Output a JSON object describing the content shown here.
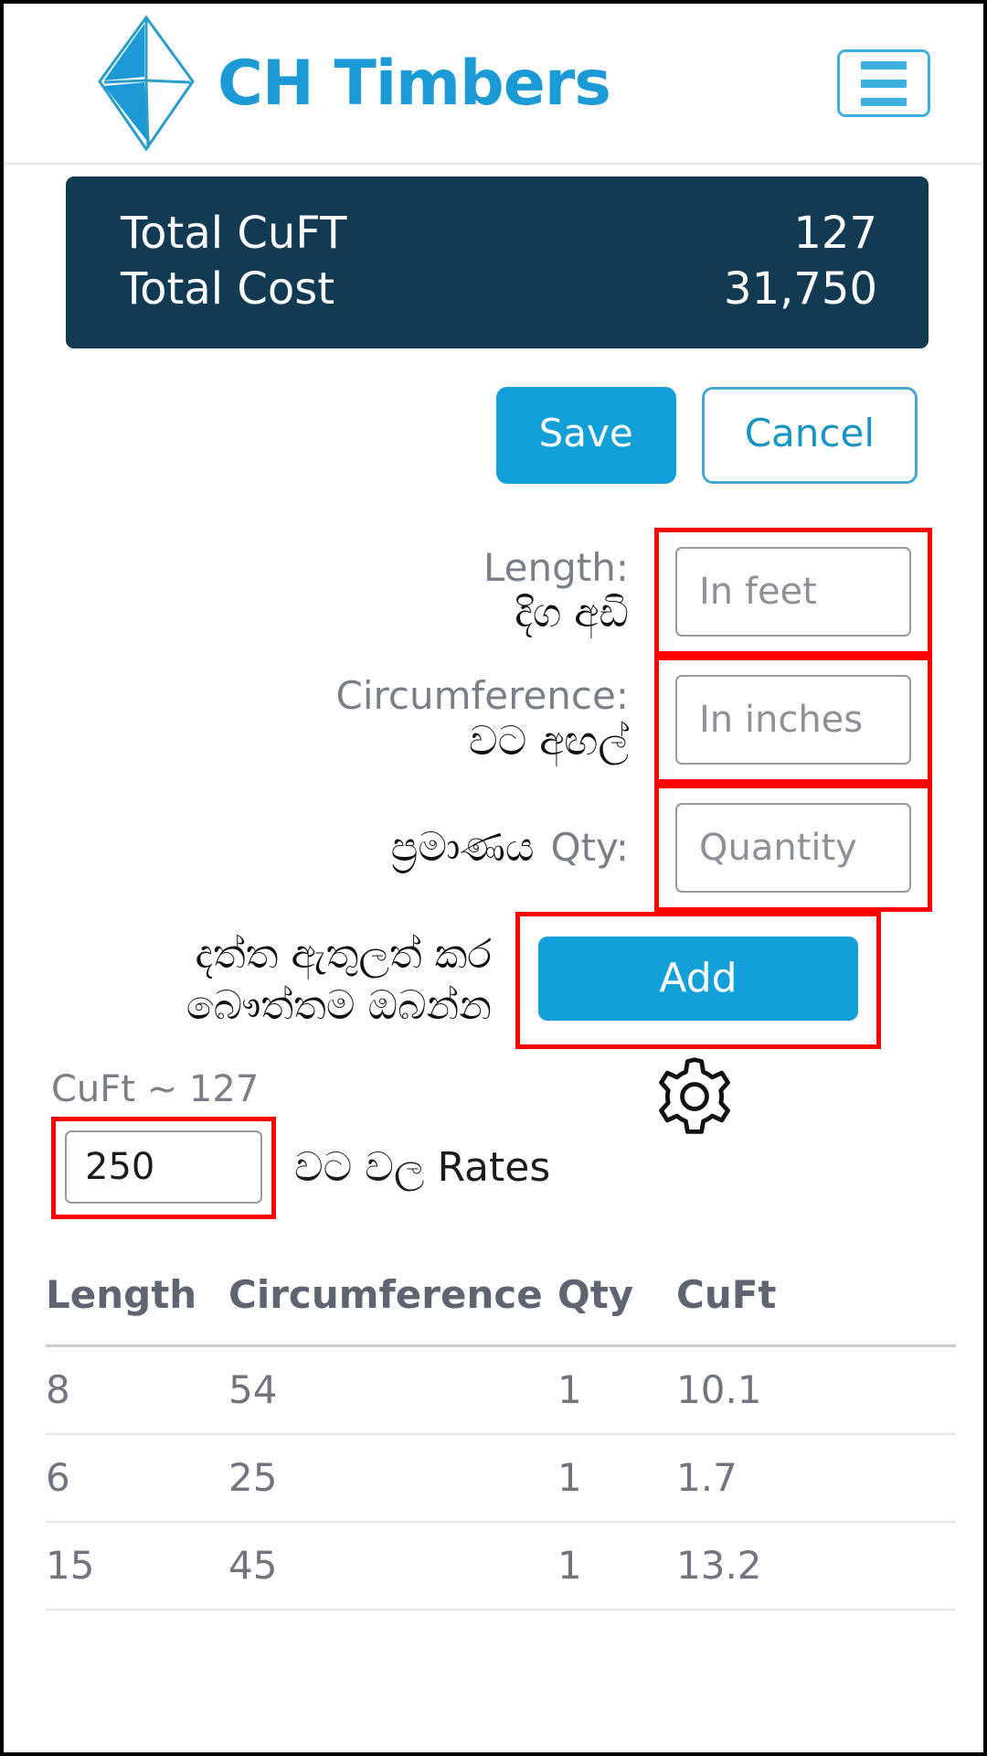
{
  "header": {
    "brand_name": "CH Timbers",
    "logo_icon": "octahedron-diamond-icon",
    "menu_icon": "hamburger-menu-icon"
  },
  "summary": {
    "rows": [
      {
        "label": "Total CuFT",
        "value": "127"
      },
      {
        "label": "Total Cost",
        "value": "31,750"
      }
    ]
  },
  "actions": {
    "save_label": "Save",
    "cancel_label": "Cancel"
  },
  "form": {
    "length": {
      "label_en": "Length:",
      "label_si": "දිග අඩි",
      "placeholder": "In feet",
      "value": ""
    },
    "circumference": {
      "label_en": "Circumference:",
      "label_si": "වට අඟල්",
      "placeholder": "In inches",
      "value": ""
    },
    "qty": {
      "label_en": "Qty:",
      "label_si": "ප්‍රමාණය",
      "placeholder": "Quantity",
      "value": ""
    },
    "add": {
      "note_line1": "දත්ත ඇතුලත් කර",
      "note_line2": "බෞත්තම ඔබන්න",
      "button_label": "Add"
    }
  },
  "rate": {
    "cuft_note": "CuFt ~ 127",
    "value": "250",
    "label": "වට වල Rates",
    "settings_icon": "gear-icon"
  },
  "table": {
    "columns": [
      "Length",
      "Circumference",
      "Qty",
      "CuFt"
    ],
    "rows": [
      {
        "length": "8",
        "circumference": "54",
        "qty": "1",
        "cuft": "10.1"
      },
      {
        "length": "6",
        "circumference": "25",
        "qty": "1",
        "cuft": "1.7"
      },
      {
        "length": "15",
        "circumference": "45",
        "qty": "1",
        "cuft": "13.2"
      }
    ]
  },
  "colors": {
    "brand_cyan": "#1c9ad6",
    "button_blue": "#13a0d8",
    "summary_navy": "#123a52",
    "highlight_red": "#ff0000",
    "muted_text": "#7a7f87"
  }
}
